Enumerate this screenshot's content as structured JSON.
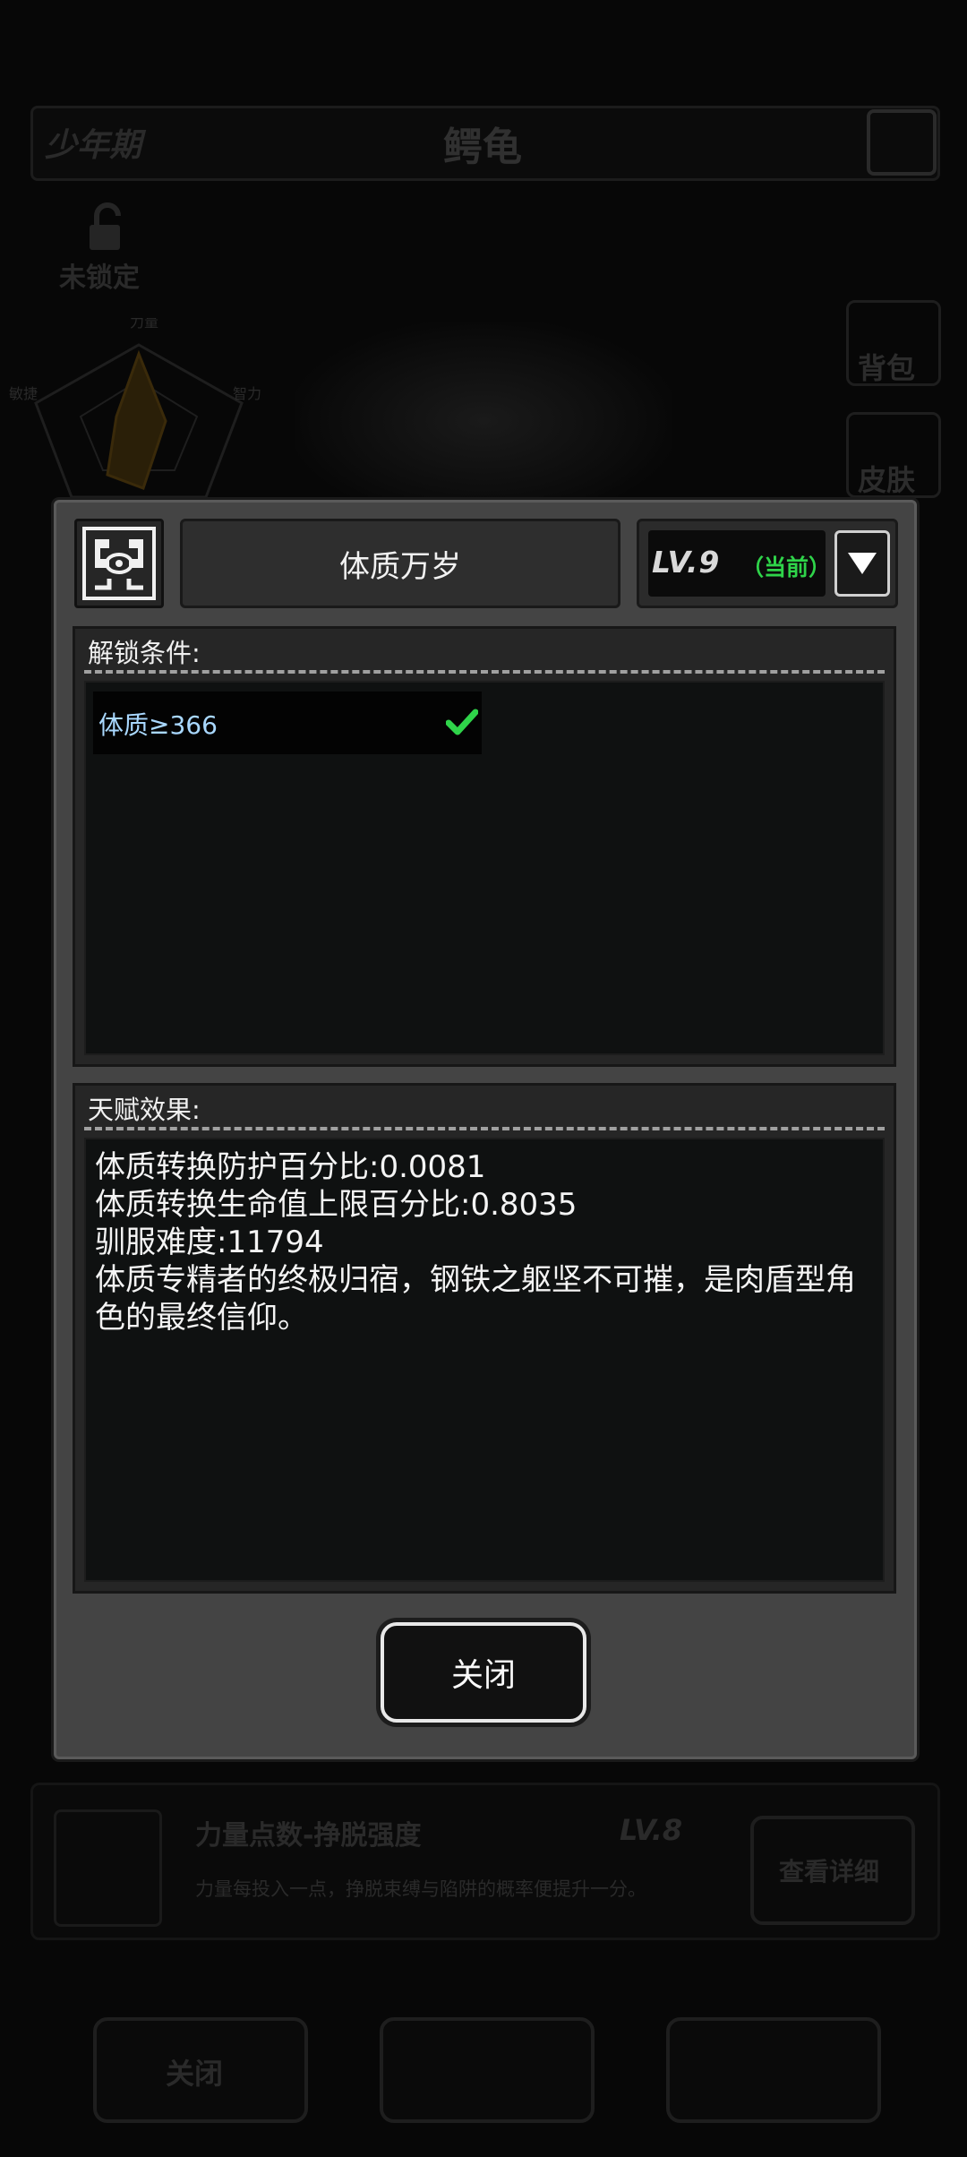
{
  "background": {
    "stage_label": "少年期",
    "creature_name": "鳄龟",
    "lock_label": "未锁定",
    "radar_labels": [
      "力量",
      "智力",
      "敏捷"
    ],
    "side_buttons": [
      "背包",
      "皮肤"
    ],
    "skill": {
      "title": "力量点数-挣脱强度",
      "level": "LV.8",
      "description": "力量每投入一点，挣脱束缚与陷阱的概率便提升一分。",
      "detail_button": "查看详细"
    },
    "bottom_close": "关闭"
  },
  "modal": {
    "talent_name": "体质万岁",
    "level": "LV.9",
    "level_status": "（当前）",
    "unlock_section": {
      "title": "解锁条件:",
      "conditions": [
        {
          "text": "体质≥366",
          "met": true
        }
      ]
    },
    "effect_section": {
      "title": "天赋效果:",
      "lines": [
        "体质转换防护百分比:0.0081",
        "体质转换生命值上限百分比:0.8035",
        "驯服难度:11794",
        "体质专精者的终极归宿，钢铁之躯坚不可摧，是肉盾型角色的最终信仰。"
      ]
    },
    "close_button": "关闭"
  },
  "colors": {
    "modal_bg": "#444444",
    "status_green": "#2fd44a",
    "condition_text": "#a9d8ff"
  }
}
